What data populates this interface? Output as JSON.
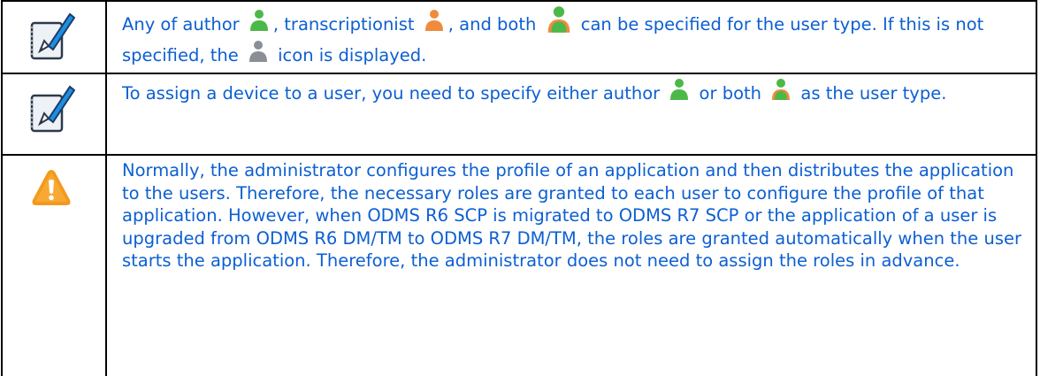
{
  "notes": [
    {
      "kind": "note",
      "icon": "note-pencil-icon",
      "text_parts": [
        "Any of author ",
        ", transcriptionist ",
        ", and both ",
        " can be specified for the user type. If this is not specified, the ",
        " icon is displayed."
      ]
    },
    {
      "kind": "note",
      "icon": "note-pencil-icon",
      "text_parts": [
        "To assign a device to a user, you need to specify either author ",
        " or both ",
        " as the user type."
      ]
    },
    {
      "kind": "caution",
      "icon": "warning-icon",
      "text": "Normally, the administrator configures the profile of an application and then distributes the application to the users. Therefore, the necessary roles are granted to each user to configure the profile of that application. However, when ODMS R6 SCP is migrated to ODMS R7 SCP or the application of a user is upgraded from ODMS R6 DM/TM to ODMS R7 DM/TM, the roles are granted automatically when the user starts the application. Therefore, the administrator does not need to assign the roles in advance."
    }
  ],
  "colors": {
    "text": "#0c5fd2",
    "border": "#000000",
    "author_user": "#4cb848",
    "transcriptionist_user": "#f08a3c",
    "unspecified_user": "#8a8f96",
    "warning_fill": "#f39a1e"
  },
  "user_type_icons": [
    "author-user-icon",
    "transcriptionist-user-icon",
    "both-user-icon",
    "unspecified-user-icon"
  ]
}
